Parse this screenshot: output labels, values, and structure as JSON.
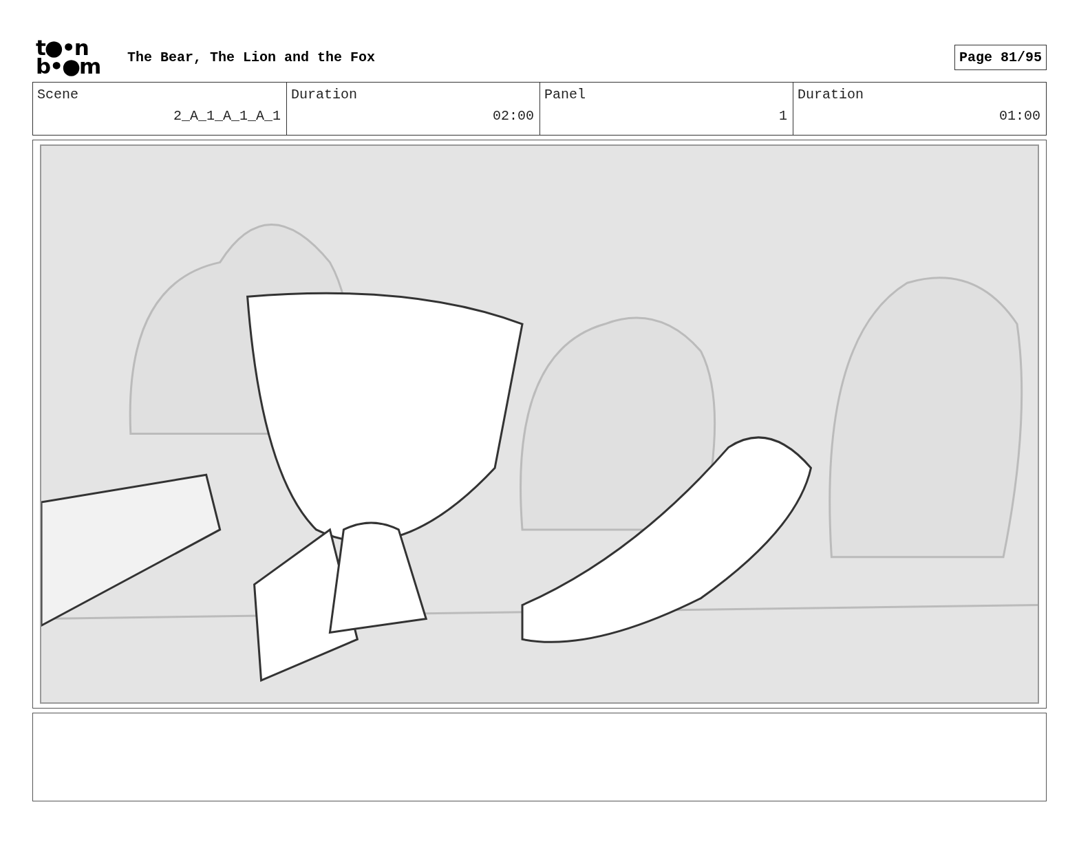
{
  "logo": {
    "lines": [
      "t●•n",
      "b•●m"
    ]
  },
  "title": "The Bear, The Lion and the Fox",
  "page": "Page 81/95",
  "info": [
    {
      "kind": "label",
      "text": "Scene"
    },
    {
      "kind": "value",
      "text": "2_A_1_A_1_A_1"
    },
    {
      "kind": "label",
      "text": "Duration"
    },
    {
      "kind": "value",
      "text": "02:00"
    },
    {
      "kind": "label",
      "text": "Panel"
    },
    {
      "kind": "value",
      "text": "1"
    },
    {
      "kind": "label",
      "text": "Duration"
    },
    {
      "kind": "value",
      "text": "01:00"
    }
  ]
}
